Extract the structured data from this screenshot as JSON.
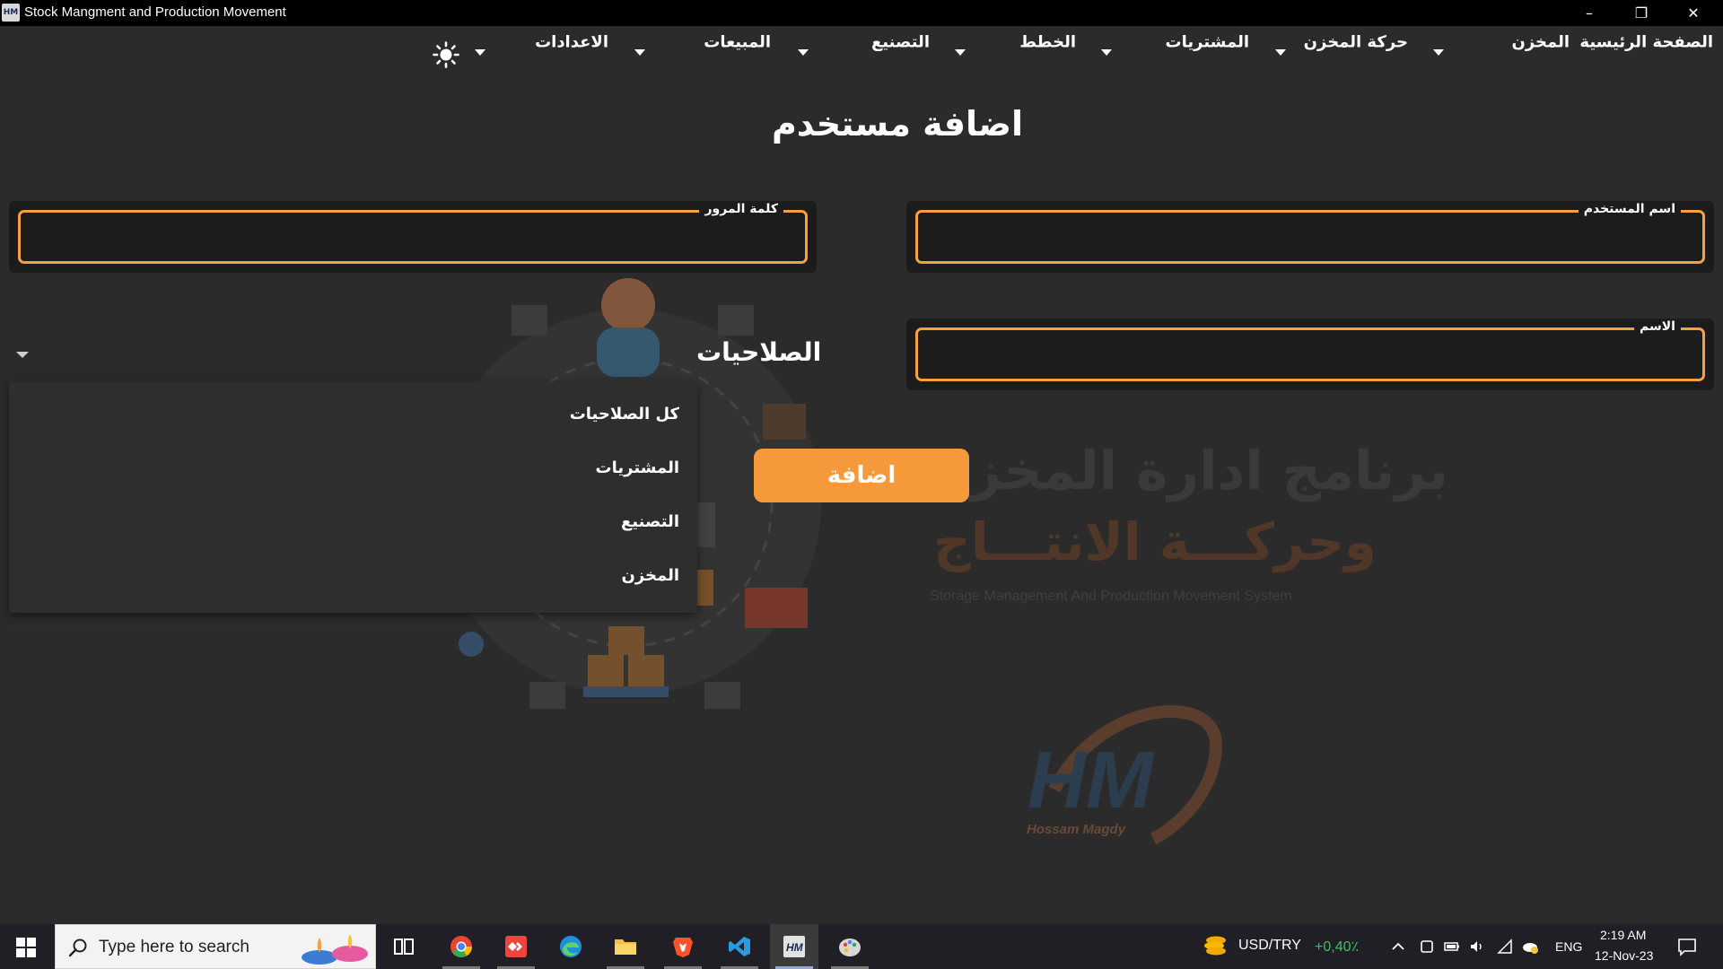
{
  "window": {
    "title": "Stock Mangment and Production Movement",
    "icon_text": "HM",
    "minimize": "–",
    "restore": "❐",
    "close": "✕"
  },
  "menu": {
    "home": "الصفحة الرئيسية",
    "store": "المخزن",
    "store_movement": "حركة المخزن",
    "purchases": "المشتريات",
    "plans": "الخطط",
    "manufacturing": "التصنيع",
    "sales": "المبيعات",
    "settings": "الاعدادات",
    "theme_icon": "sun-icon"
  },
  "page": {
    "title": "اضافة مستخدم"
  },
  "form": {
    "username_label": "اسم المستخدم",
    "username_value": "",
    "password_label": "كلمة المرور",
    "password_value": "",
    "name_label": "الاسم",
    "name_value": "",
    "permissions_label": "الصلاحيات",
    "permissions_options": [
      "كل الصلاحيات",
      "المشتريات",
      "التصنيع",
      "المخزن"
    ],
    "add_button": "اضافة"
  },
  "watermark": {
    "line1": "برنامج ادارة المخزن",
    "line2": "وحركـــة الانتـــاج",
    "line3": "Storage Management And Production Movement System",
    "logo_text": "HM",
    "signature": "Hossam Magdy"
  },
  "taskbar": {
    "search_placeholder": "Type here to search",
    "currency": "USD/TRY",
    "currency_change": "+0,40٪",
    "language": "ENG",
    "time": "2:19 AM",
    "date": "12-Nov-23",
    "colors": {
      "accent": "#f5993a",
      "positive": "#3fbf5f"
    }
  }
}
